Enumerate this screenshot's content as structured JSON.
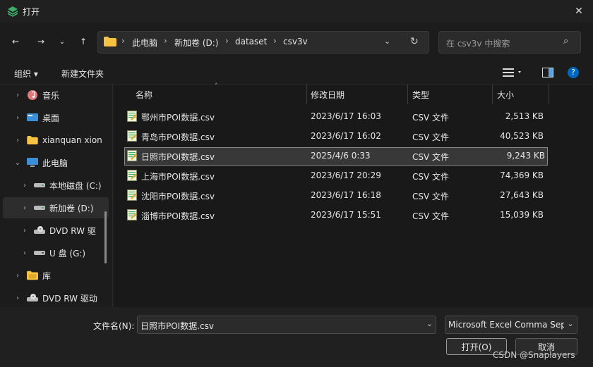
{
  "window": {
    "title": "打开"
  },
  "address": {
    "crumbs": [
      "此电脑",
      "新加卷 (D:)",
      "dataset",
      "csv3v"
    ]
  },
  "search": {
    "placeholder": "在 csv3v 中搜索"
  },
  "commands": {
    "organize": "组织 ▾",
    "new_folder": "新建文件夹"
  },
  "nav": {
    "items": [
      {
        "label": "音乐",
        "icon": "music-icon"
      },
      {
        "label": "桌面",
        "icon": "desktop-icon"
      },
      {
        "label": "xianquan xion",
        "icon": "folder-icon"
      },
      {
        "label": "此电脑",
        "icon": "computer-icon"
      },
      {
        "label": "本地磁盘 (C:)",
        "icon": "drive-icon"
      },
      {
        "label": "新加卷 (D:)",
        "icon": "drive-icon"
      },
      {
        "label": "DVD RW 驱",
        "icon": "dvd-icon"
      },
      {
        "label": "U 盘 (G:)",
        "icon": "usb-drive-icon"
      },
      {
        "label": "库",
        "icon": "library-icon"
      },
      {
        "label": "DVD RW 驱动",
        "icon": "dvd-icon"
      }
    ]
  },
  "columns": {
    "name": "名称",
    "date": "修改日期",
    "type": "类型",
    "size": "大小"
  },
  "files": [
    {
      "name": "鄂州市POI数据.csv",
      "date": "2023/6/17 16:03",
      "type": "CSV 文件",
      "size": "2,513 KB"
    },
    {
      "name": "青岛市POI数据.csv",
      "date": "2023/6/17 16:02",
      "type": "CSV 文件",
      "size": "40,523 KB"
    },
    {
      "name": "日照市POI数据.csv",
      "date": "2025/4/6 0:33",
      "type": "CSV 文件",
      "size": "9,243 KB"
    },
    {
      "name": "上海市POI数据.csv",
      "date": "2023/6/17 20:29",
      "type": "CSV 文件",
      "size": "74,369 KB"
    },
    {
      "name": "沈阳市POI数据.csv",
      "date": "2023/6/17 16:18",
      "type": "CSV 文件",
      "size": "27,643 KB"
    },
    {
      "name": "淄博市POI数据.csv",
      "date": "2023/6/17 15:51",
      "type": "CSV 文件",
      "size": "15,039 KB"
    }
  ],
  "footer": {
    "filename_label": "文件名(N):",
    "filename_value": "日照市POI数据.csv",
    "filetype_value": "Microsoft Excel Comma Sep",
    "open_label": "打开(O)",
    "cancel_label": "取消",
    "watermark": "CSDN @Snaplayers"
  },
  "colors": {
    "accent": "#0067c0",
    "folder": "#f6c343",
    "selected_row": "#383838"
  }
}
